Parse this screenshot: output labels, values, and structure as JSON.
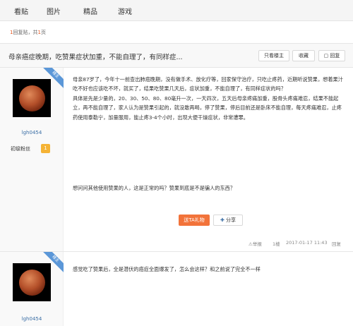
{
  "nav": {
    "tabs": [
      "看贴",
      "图片",
      "精品",
      "游戏"
    ]
  },
  "pager": {
    "count": "1",
    "prefix": "",
    "replies_text": "回复贴，共",
    "pages": "1",
    "pages_suffix": "页"
  },
  "thread": {
    "title": "母亲癌症晚期，吃赞果症状加重，不能自理了，有同样症...",
    "buttons": {
      "only_op": "只看楼主",
      "favorite": "收藏",
      "reply": "回复"
    }
  },
  "posts": [
    {
      "username": "lgh0454",
      "level": "初级粉丝",
      "level_num": "1",
      "badge": "楼主",
      "paragraphs": [
        "母亲87岁了，今年十一前查出肺癌晚期，没有做手术、放化疗等，回家保守治疗，只吃止疼药，近期听说赞果，想着果汁吃不好也应该吃不坏，就买了，结果吃赞果几天后，症状加重，不能自理了，有同样症状的吗？",
        "具体是先是少量的，20、30、50、80、80毫升一次，一天四次，五天后母亲疼痛加重，股骨头疼痛难忍，结果不能起立，再不能自理了，家人认为是赞果引起的，就没敢再喝，停了赞果，停后目前还是卧床不能自理，每天疼痛难忍，止疼药使用泰勒宁，加量服用，能止疼3-4个小时，出现大便干燥症状，非常遭罪。"
      ],
      "question": "想问问其他使用赞果的人，这是正常的吗？赞果到底是不是骗人的东西？",
      "gift": "送TA礼物",
      "share": "分享",
      "report": "举报",
      "floor": "1楼",
      "time": "2017-01-17 11:43",
      "reply": "回复"
    },
    {
      "username": "lgh0454",
      "badge": "楼主",
      "text": "感觉吃了赞果后，全是潜伏的癌症全面爆发了，怎么会这样？和之前说了完全不一样"
    }
  ],
  "colors": {
    "accent": "#f2733a",
    "link": "#3a6ea5",
    "badge": "#5b97d8"
  }
}
